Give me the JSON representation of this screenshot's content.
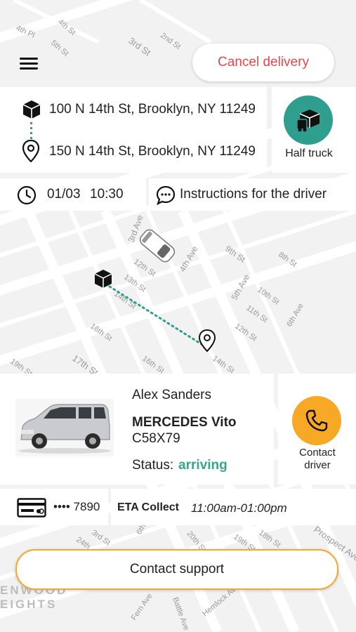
{
  "header": {
    "cancel_label": "Cancel delivery"
  },
  "route": {
    "pickup": "100 N 14th St, Brooklyn, NY 11249",
    "dropoff": "150 N 14th St, Brooklyn, NY 11249",
    "vehicle_type": "Half truck"
  },
  "schedule": {
    "date": "01/03",
    "time": "10:30",
    "instructions_label": "Instructions for the driver"
  },
  "map": {
    "streets": [
      "4th Pl",
      "4th St",
      "5th St",
      "3rd St",
      "2nd St",
      "3rd Ave",
      "4th Ave",
      "9th St",
      "8th St",
      "12th St",
      "13th St",
      "14th St",
      "5th Ave",
      "10th St",
      "11th St",
      "12th St",
      "6th Ave",
      "16th St",
      "17th St",
      "16th St",
      "14th St",
      "19th St",
      "3rd St",
      "24th",
      "6th",
      "20th St",
      "19th St",
      "18th St",
      "Prospect Ave",
      "Battle Ave",
      "Fern Ave",
      "Hemlock Ave"
    ],
    "neighborhood": [
      "ENWOOD",
      "EIGHTS"
    ]
  },
  "driver": {
    "name": "Alex Sanders",
    "car_model": "MERCEDES Vito",
    "plate": "C58X79",
    "status_label": "Status:",
    "status_value": "arriving",
    "contact_label_1": "Contact",
    "contact_label_2": "driver"
  },
  "payment": {
    "card_last": "•••• 7890",
    "eta_label": "ETA Collect",
    "eta_window": "11:00am-01:00pm"
  },
  "support": {
    "label": "Contact support"
  },
  "colors": {
    "accent_red": "#e8474b",
    "teal": "#2f9e8f",
    "orange": "#f7a824",
    "status_green": "#39a58c"
  }
}
